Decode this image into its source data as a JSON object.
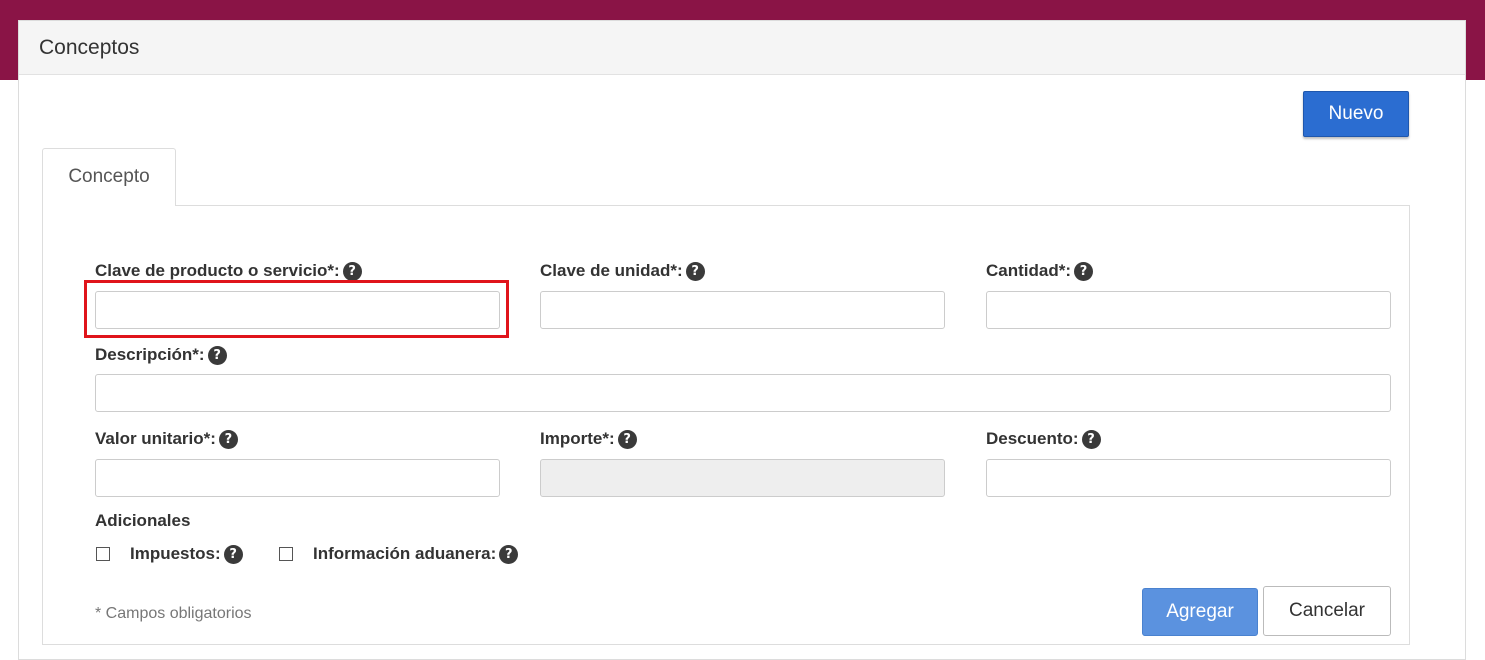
{
  "panel": {
    "title": "Conceptos",
    "new_button": "Nuevo"
  },
  "tabs": [
    {
      "label": "Concepto",
      "active": true
    }
  ],
  "form": {
    "clave_producto": {
      "label": "Clave de producto o servicio*:",
      "value": ""
    },
    "clave_unidad": {
      "label": "Clave de unidad*:",
      "value": ""
    },
    "cantidad": {
      "label": "Cantidad*:",
      "value": ""
    },
    "descripcion": {
      "label": "Descripción*:",
      "value": ""
    },
    "valor_unitario": {
      "label": "Valor unitario*:",
      "value": ""
    },
    "importe": {
      "label": "Importe*:",
      "value": "",
      "disabled": true
    },
    "descuento": {
      "label": "Descuento:",
      "value": ""
    },
    "adicionales": {
      "label": "Adicionales",
      "impuestos": {
        "label": "Impuestos:",
        "checked": false
      },
      "informacion_aduanera": {
        "label": "Información aduanera:",
        "checked": false
      }
    },
    "required_note": "* Campos obligatorios",
    "add_button": "Agregar",
    "cancel_button": "Cancelar"
  },
  "colors": {
    "brand_bar": "#8a1446",
    "primary_button": "#2b6dd1",
    "highlight": "#e0141b"
  },
  "icons": {
    "help": "question-circle-icon"
  }
}
